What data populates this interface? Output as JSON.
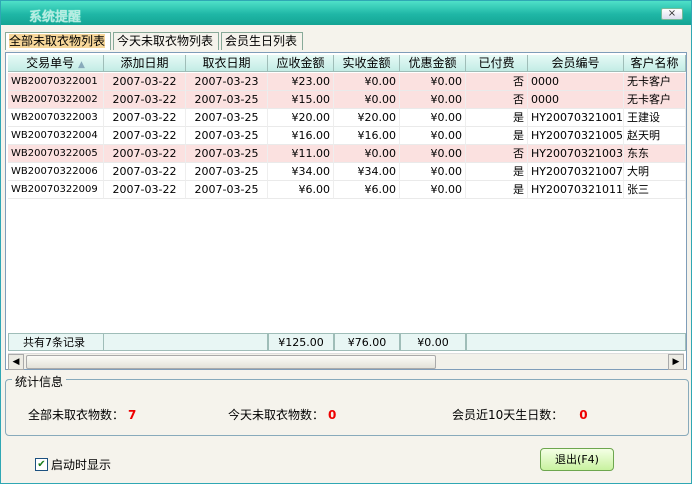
{
  "window": {
    "title": "系统提醒",
    "close_label": "×"
  },
  "tabs": [
    {
      "label": "全部未取衣物列表",
      "active": true
    },
    {
      "label": "今天未取衣物列表",
      "active": false
    },
    {
      "label": "会员生日列表",
      "active": false
    }
  ],
  "grid": {
    "columns": [
      "交易单号",
      "添加日期",
      "取衣日期",
      "应收金额",
      "实收金额",
      "优惠金额",
      "已付费",
      "会员编号",
      "客户名称"
    ],
    "sort_indicator": "▲",
    "rows": [
      {
        "highlight": true,
        "cells": [
          "WB20070322001",
          "2007-03-22",
          "2007-03-23",
          "¥23.00",
          "¥0.00",
          "¥0.00",
          "否",
          "0000",
          "无卡客户"
        ]
      },
      {
        "highlight": true,
        "cells": [
          "WB20070322002",
          "2007-03-22",
          "2007-03-25",
          "¥15.00",
          "¥0.00",
          "¥0.00",
          "否",
          "0000",
          "无卡客户"
        ]
      },
      {
        "highlight": false,
        "cells": [
          "WB20070322003",
          "2007-03-22",
          "2007-03-25",
          "¥20.00",
          "¥20.00",
          "¥0.00",
          "是",
          "HY20070321001",
          "王建设"
        ]
      },
      {
        "highlight": false,
        "cells": [
          "WB20070322004",
          "2007-03-22",
          "2007-03-25",
          "¥16.00",
          "¥16.00",
          "¥0.00",
          "是",
          "HY20070321005",
          "赵天明"
        ]
      },
      {
        "highlight": true,
        "cells": [
          "WB20070322005",
          "2007-03-22",
          "2007-03-25",
          "¥11.00",
          "¥0.00",
          "¥0.00",
          "否",
          "HY20070321003",
          "东东"
        ]
      },
      {
        "highlight": false,
        "cells": [
          "WB20070322006",
          "2007-03-22",
          "2007-03-25",
          "¥34.00",
          "¥34.00",
          "¥0.00",
          "是",
          "HY20070321007",
          "大明"
        ]
      },
      {
        "highlight": false,
        "cells": [
          "WB20070322009",
          "2007-03-22",
          "2007-03-25",
          "¥6.00",
          "¥6.00",
          "¥0.00",
          "是",
          "HY20070321011",
          "张三"
        ]
      }
    ],
    "footer": {
      "count_text": "共有7条记录",
      "total_due": "¥125.00",
      "total_received": "¥76.00",
      "total_discount": "¥0.00"
    },
    "scroll_left": "◀",
    "scroll_right": "▶"
  },
  "stats": {
    "title": "统计信息",
    "all_label": "全部未取衣物数：",
    "all_value": "7",
    "today_label": "今天未取衣物数：",
    "today_value": "0",
    "birthday_label": "会员近10天生日数：",
    "birthday_value": "0"
  },
  "startup_checkbox": {
    "label": "启动时显示",
    "checked": true,
    "mark": "✔"
  },
  "exit_button": {
    "label": "退出(F4)"
  }
}
